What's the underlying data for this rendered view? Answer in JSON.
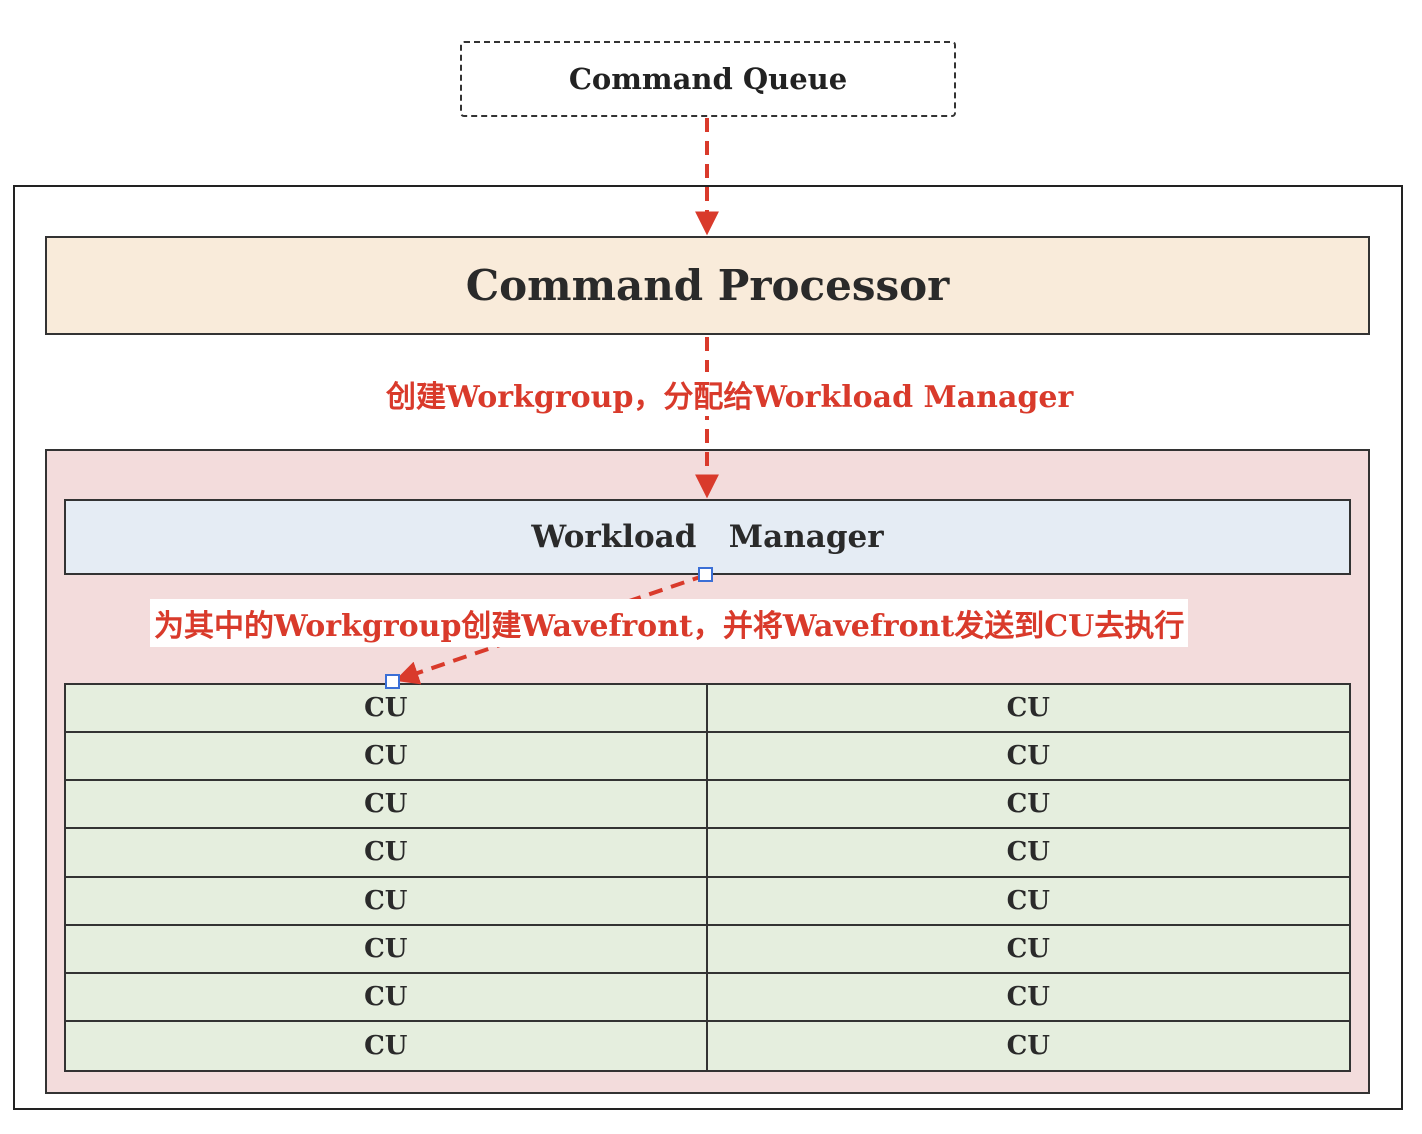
{
  "command_queue": {
    "label": "Command Queue"
  },
  "command_processor": {
    "label": "Command Processor"
  },
  "annotation_top": "创建Workgroup，分配给Workload Manager",
  "workload_manager": {
    "label": "Workload   Manager"
  },
  "annotation_bottom": "为其中的Workgroup创建Wavefront，并将Wavefront发送到CU去执行",
  "cu_grid": {
    "rows": 8,
    "columns": 2,
    "cells": [
      "CU",
      "CU",
      "CU",
      "CU",
      "CU",
      "CU",
      "CU",
      "CU",
      "CU",
      "CU",
      "CU",
      "CU",
      "CU",
      "CU",
      "CU",
      "CU"
    ]
  },
  "colors": {
    "arrow": "#d93a2b",
    "command_processor_fill": "#f9ebda",
    "pink_container_fill": "#f3dcdc",
    "workload_manager_fill": "#e5ecf4",
    "cu_fill": "#e5eede",
    "handle": "#3b6fd6"
  }
}
